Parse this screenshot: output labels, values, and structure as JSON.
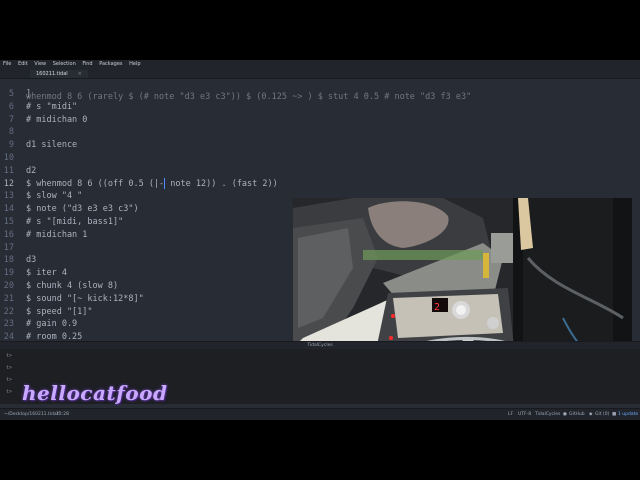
{
  "menubar": [
    "File",
    "Edit",
    "View",
    "Selection",
    "Find",
    "Packages",
    "Help"
  ],
  "tab": {
    "label": "160211.tidal"
  },
  "editor": {
    "partial_top": "whenmod 8 6 (rarely $ (# note \"d3 e3 c3\")) $ (0.125 ~> ) $ stut 4 0.5 # note \"d3 f3 e3\"",
    "lines": [
      {
        "n": "5",
        "text": "]"
      },
      {
        "n": "6",
        "text": "# s \"midi\""
      },
      {
        "n": "7",
        "text": "# midichan 0"
      },
      {
        "n": "8",
        "text": ""
      },
      {
        "n": "9",
        "text": "d1 silence"
      },
      {
        "n": "10",
        "text": ""
      },
      {
        "n": "11",
        "text": "d2"
      },
      {
        "n": "12",
        "text": "$ whenmod 8 6 ((off 0.5 (|-",
        "after_cursor": " note 12)) . (fast 2))"
      },
      {
        "n": "13",
        "text": "$ slow \"4 \""
      },
      {
        "n": "14",
        "text": "$ note (\"d3 e3 e3 c3\")"
      },
      {
        "n": "15",
        "text": "# s \"[midi, bass1]\""
      },
      {
        "n": "16",
        "text": "# midichan 1"
      },
      {
        "n": "17",
        "text": ""
      },
      {
        "n": "18",
        "text": "d3"
      },
      {
        "n": "19",
        "text": "$ iter 4"
      },
      {
        "n": "20",
        "text": "$ chunk 4 (slow 8)"
      },
      {
        "n": "21",
        "text": "$ sound \"[~ kick:12*8]\""
      },
      {
        "n": "22",
        "text": "$ speed \"[1]\""
      },
      {
        "n": "23",
        "text": "# gain 0.9"
      },
      {
        "n": "24",
        "text": "# room 0.25"
      }
    ]
  },
  "panel": {
    "title": "TidalCycles",
    "prompts": [
      "t>",
      "t>",
      "t>",
      "t>"
    ]
  },
  "watermark": "hellocatfood",
  "status": {
    "path": "~/Desktop/160211.tidal*",
    "position": "12:28",
    "encoding_lf": "LF",
    "encoding": "UTF-8",
    "grammar": "TidalCycles",
    "github": "GitHub",
    "git": "Git (0)",
    "updates": "1 update"
  },
  "colors": {
    "background": "#282c34",
    "accent": "#528bff",
    "watermark": "#c9a8ff"
  }
}
